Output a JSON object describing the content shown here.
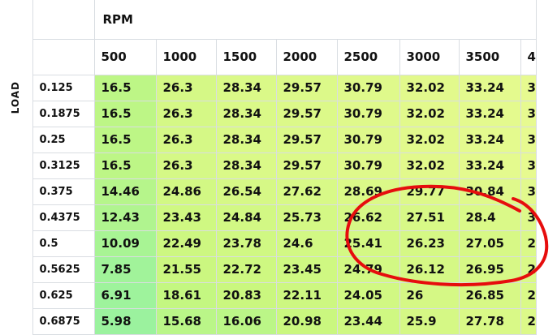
{
  "title": "RPM",
  "side_label": "LOAD",
  "rpm_columns": [
    "500",
    "1000",
    "1500",
    "2000",
    "2500",
    "3000",
    "3500",
    "4"
  ],
  "load_rows": [
    {
      "load": "0.125",
      "values": [
        "16.5",
        "26.3",
        "28.34",
        "29.57",
        "30.79",
        "32.02",
        "33.24",
        "3"
      ]
    },
    {
      "load": "0.1875",
      "values": [
        "16.5",
        "26.3",
        "28.34",
        "29.57",
        "30.79",
        "32.02",
        "33.24",
        "3"
      ]
    },
    {
      "load": "0.25",
      "values": [
        "16.5",
        "26.3",
        "28.34",
        "29.57",
        "30.79",
        "32.02",
        "33.24",
        "3"
      ]
    },
    {
      "load": "0.3125",
      "values": [
        "16.5",
        "26.3",
        "28.34",
        "29.57",
        "30.79",
        "32.02",
        "33.24",
        "3"
      ]
    },
    {
      "load": "0.375",
      "values": [
        "14.46",
        "24.86",
        "26.54",
        "27.62",
        "28.69",
        "29.77",
        "30.84",
        "3"
      ]
    },
    {
      "load": "0.4375",
      "values": [
        "12.43",
        "23.43",
        "24.84",
        "25.73",
        "26.62",
        "27.51",
        "28.4",
        "3"
      ]
    },
    {
      "load": "0.5",
      "values": [
        "10.09",
        "22.49",
        "23.78",
        "24.6",
        "25.41",
        "26.23",
        "27.05",
        "2"
      ]
    },
    {
      "load": "0.5625",
      "values": [
        "7.85",
        "21.55",
        "22.72",
        "23.45",
        "24.79",
        "26.12",
        "26.95",
        "2"
      ]
    },
    {
      "load": "0.625",
      "values": [
        "6.91",
        "18.61",
        "20.83",
        "22.11",
        "24.05",
        "26",
        "26.85",
        "2"
      ]
    },
    {
      "load": "0.6875",
      "values": [
        "5.98",
        "15.68",
        "16.06",
        "20.98",
        "23.44",
        "25.9",
        "27.78",
        "2"
      ]
    }
  ],
  "colors": {
    "cell_low": "#98f2a0",
    "cell_mid": "#c8f77e",
    "cell_high": "#e8fa90",
    "annotation": "#e60d0d",
    "grid_line": "#d9dde2"
  }
}
